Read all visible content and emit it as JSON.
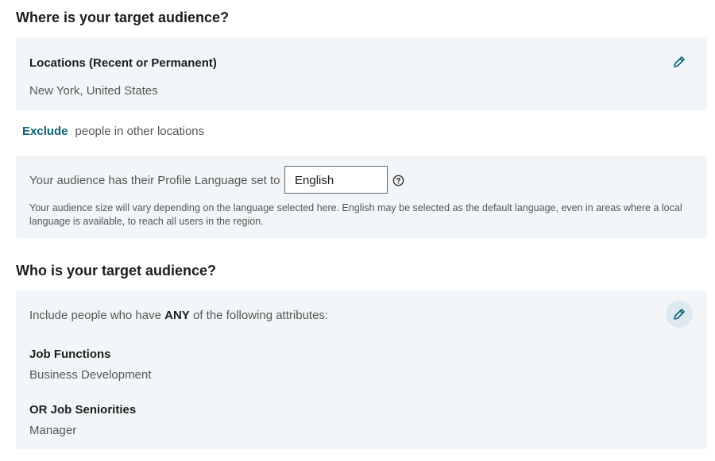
{
  "where_section": {
    "title": "Where is your target audience?",
    "locations_label": "Locations (Recent or Permanent)",
    "locations_value": "New York, United States",
    "exclude_link": "Exclude",
    "exclude_text": "people in other locations",
    "language_label": "Your audience has their Profile Language set to",
    "language_value": "English",
    "language_note": "Your audience size will vary depending on the language selected here. English may be selected as the default language, even in areas where a local language is available, to reach all users in the region."
  },
  "who_section": {
    "title": "Who is your target audience?",
    "intro_prefix": "Include people who have",
    "intro_emphasis": "ANY",
    "intro_suffix": "of the following attributes:",
    "attributes": [
      {
        "label": "Job Functions",
        "value": "Business Development"
      },
      {
        "label": "OR Job Seniorities",
        "value": "Manager"
      }
    ]
  },
  "colors": {
    "accent": "#0b6477",
    "panel_bg": "#f3f6f8"
  },
  "icons": [
    "pencil-icon",
    "help-circle-icon"
  ]
}
